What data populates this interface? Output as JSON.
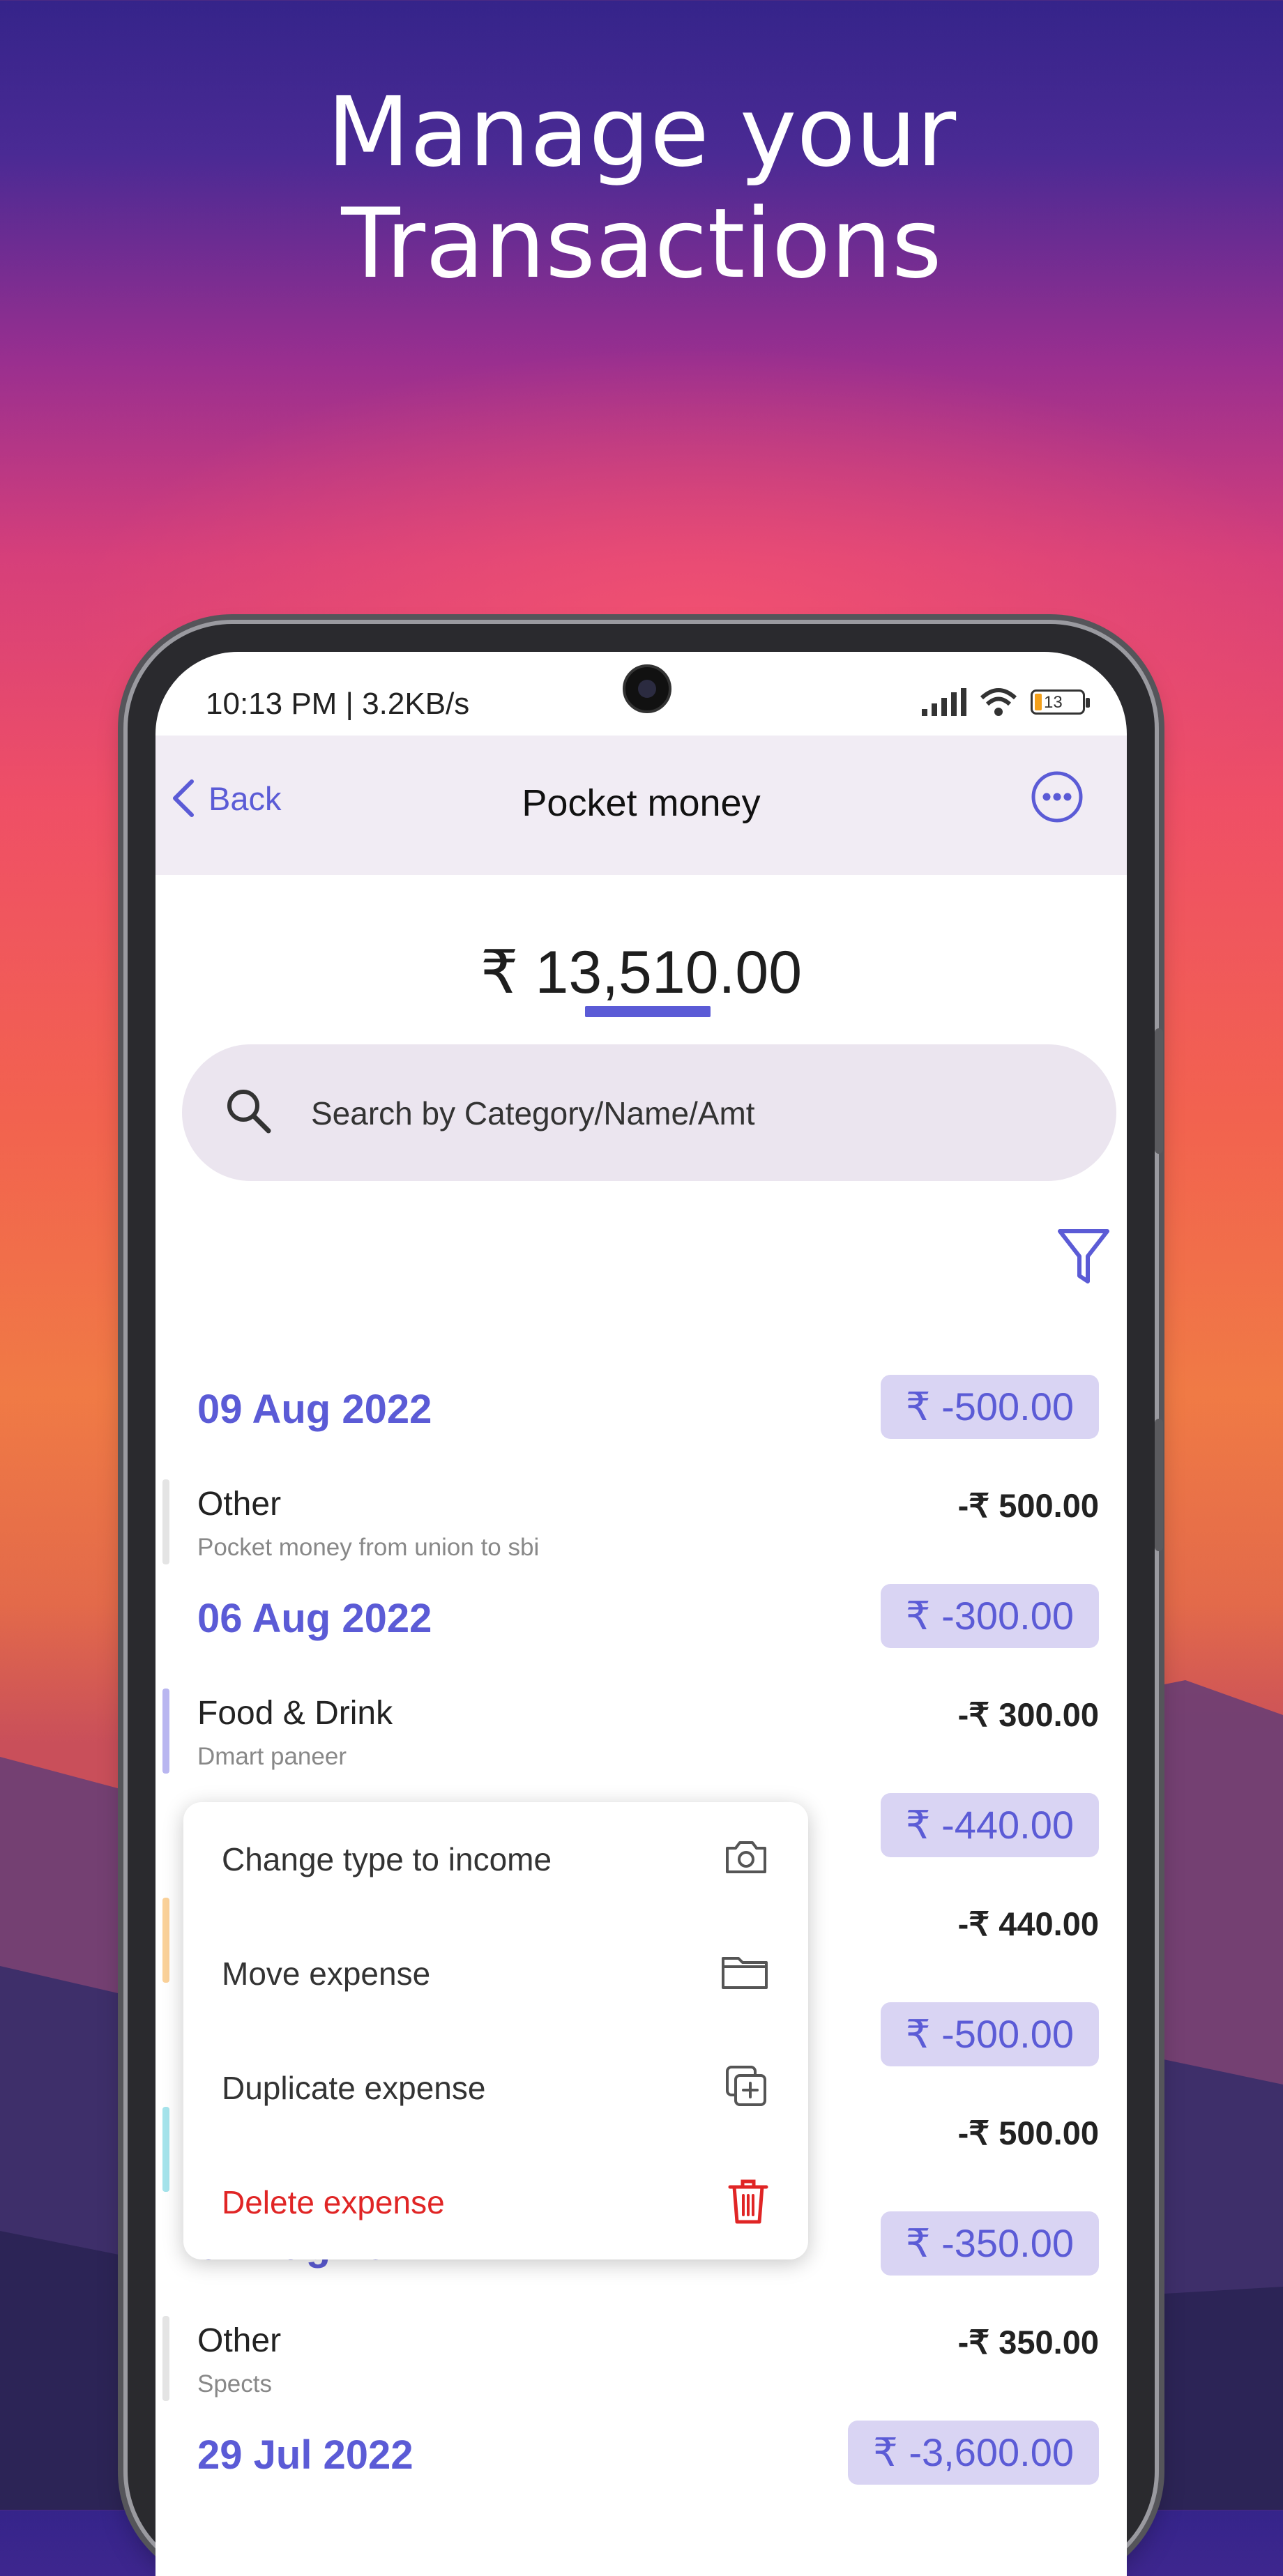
{
  "promo": {
    "headline_line1": "Manage your",
    "headline_line2": "Transactions"
  },
  "status_bar": {
    "time": "10:13 PM | 3.2KB/s",
    "battery": "13"
  },
  "app_bar": {
    "back_label": "Back",
    "title": "Pocket money",
    "more_icon": "more-horizontal-icon"
  },
  "balance": "₹ 13,510.00",
  "search": {
    "placeholder": "Search by Category/Name/Amt",
    "icon": "search-icon"
  },
  "filter_icon": "filter-icon",
  "groups": [
    {
      "date": "09 Aug 2022",
      "total": "₹ -500.00"
    },
    {
      "date": "06 Aug 2022",
      "total": "₹ -300.00"
    },
    {
      "date": "",
      "total": "₹ -440.00"
    },
    {
      "date": "",
      "total": "₹ -500.00"
    },
    {
      "date": "01 Aug 2022",
      "total": "₹ -350.00"
    },
    {
      "date": "29 Jul 2022",
      "total": "₹ -3,600.00"
    }
  ],
  "transactions": [
    {
      "name": "Other",
      "note": "Pocket money from union to sbi",
      "amount": "-₹ 500.00",
      "color": "#e4e4e4"
    },
    {
      "name": "Food & Drink",
      "note": "Dmart paneer",
      "amount": "-₹ 300.00",
      "color": "#b9b6f0"
    },
    {
      "name": "",
      "note": "",
      "amount": "-₹ 440.00",
      "color": "#fbd29a"
    },
    {
      "name": "",
      "note": "",
      "amount": "-₹ 500.00",
      "color": "#a6e4ec"
    },
    {
      "name": "Other",
      "note": "Spects",
      "amount": "-₹ 350.00",
      "color": "#e4e4e4"
    }
  ],
  "context_menu": [
    {
      "label": "Change type to income",
      "icon": "camera-icon"
    },
    {
      "label": "Move expense",
      "icon": "folder-icon"
    },
    {
      "label": "Duplicate expense",
      "icon": "duplicate-icon"
    },
    {
      "label": "Delete expense",
      "icon": "trash-icon",
      "color": "#e02525"
    }
  ],
  "colors": {
    "accent": "#5b5bd6",
    "badge_bg": "#d9d4f3",
    "danger": "#e02525"
  }
}
